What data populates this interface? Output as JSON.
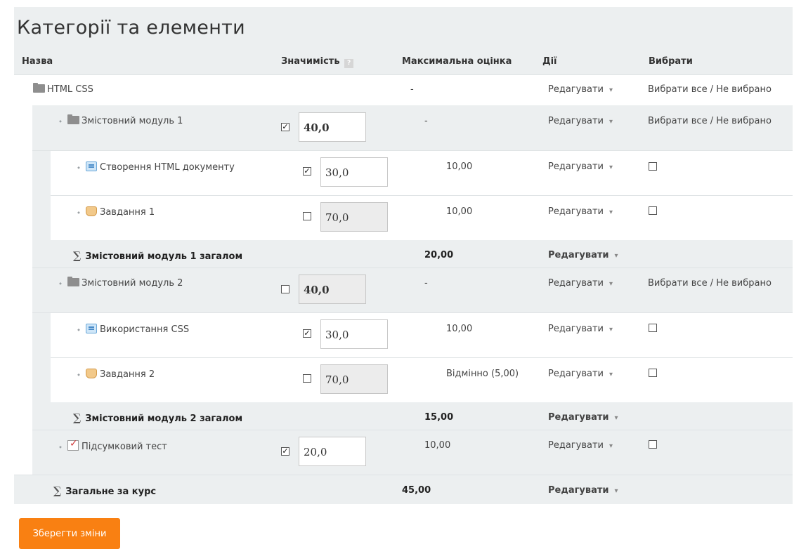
{
  "title": "Категорії та елементи",
  "columns": {
    "name": "Назва",
    "weight": "Значимість",
    "max": "Максимальна оцінка",
    "actions": "Дії",
    "select": "Вибрати"
  },
  "help_icon": "help-icon",
  "edit_label": "Редагувати",
  "select_all_label": "Вибрати все / Не вибрано",
  "rows": {
    "course": {
      "name": "HTML CSS",
      "max": "-"
    },
    "mod1": {
      "name": "Змістовний модуль 1",
      "weight": "40,0",
      "checked": true,
      "max": "-"
    },
    "item1": {
      "name": "Створення HTML документу",
      "weight": "30,0",
      "checked": true,
      "max": "10,00"
    },
    "item2": {
      "name": "Завдання 1",
      "weight": "70,0",
      "checked": false,
      "max": "10,00"
    },
    "mod1_total": {
      "name": "Змістовний модуль 1 загалом",
      "max": "20,00"
    },
    "mod2": {
      "name": "Змістовний модуль 2",
      "weight": "40,0",
      "checked": false,
      "max": "-"
    },
    "item3": {
      "name": "Використання CSS",
      "weight": "30,0",
      "checked": true,
      "max": "10,00"
    },
    "item4": {
      "name": "Завдання 2",
      "weight": "70,0",
      "checked": false,
      "max": "Відмінно (5,00)"
    },
    "mod2_total": {
      "name": "Змістовний модуль 2 загалом",
      "max": "15,00"
    },
    "quiz": {
      "name": "Підсумковий тест",
      "weight": "20,0",
      "checked": true,
      "max": "10,00"
    },
    "course_total": {
      "name": "Загальне за курс",
      "max": "45,00"
    }
  },
  "save_button": "Зберегти зміни",
  "colors": {
    "accent": "#f98012",
    "panel": "#eceff0"
  }
}
